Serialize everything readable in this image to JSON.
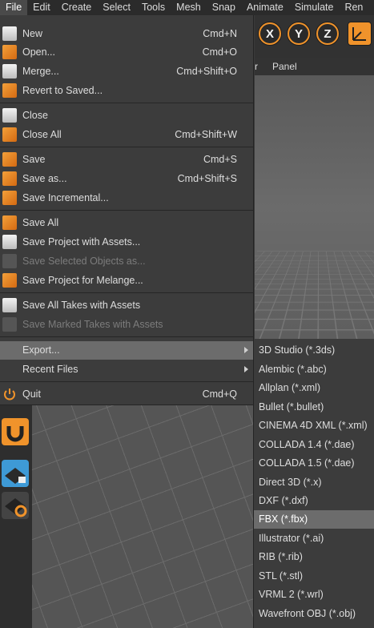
{
  "menubar": {
    "items": [
      "File",
      "Edit",
      "Create",
      "Select",
      "Tools",
      "Mesh",
      "Snap",
      "Animate",
      "Simulate",
      "Ren"
    ]
  },
  "axis_buttons": [
    "X",
    "Y",
    "Z"
  ],
  "viewport_menu": {
    "item_partial": "r",
    "panel": "Panel"
  },
  "file_menu": {
    "new": {
      "label": "New",
      "shortcut": "Cmd+N"
    },
    "open": {
      "label": "Open...",
      "shortcut": "Cmd+O"
    },
    "merge": {
      "label": "Merge...",
      "shortcut": "Cmd+Shift+O"
    },
    "revert": {
      "label": "Revert to Saved..."
    },
    "close": {
      "label": "Close"
    },
    "close_all": {
      "label": "Close All",
      "shortcut": "Cmd+Shift+W"
    },
    "save": {
      "label": "Save",
      "shortcut": "Cmd+S"
    },
    "save_as": {
      "label": "Save as...",
      "shortcut": "Cmd+Shift+S"
    },
    "save_incremental": {
      "label": "Save Incremental..."
    },
    "save_all": {
      "label": "Save All"
    },
    "save_project_assets": {
      "label": "Save Project with Assets..."
    },
    "save_selected": {
      "label": "Save Selected Objects as..."
    },
    "save_melange": {
      "label": "Save Project for Melange..."
    },
    "save_all_takes": {
      "label": "Save All Takes with Assets"
    },
    "save_marked_takes": {
      "label": "Save Marked Takes with Assets"
    },
    "export": {
      "label": "Export..."
    },
    "recent": {
      "label": "Recent Files"
    },
    "quit": {
      "label": "Quit",
      "shortcut": "Cmd+Q"
    }
  },
  "export_submenu": [
    "3D Studio (*.3ds)",
    "Alembic (*.abc)",
    "Allplan (*.xml)",
    "Bullet (*.bullet)",
    "CINEMA 4D XML (*.xml)",
    "COLLADA 1.4 (*.dae)",
    "COLLADA 1.5 (*.dae)",
    "Direct 3D (*.x)",
    "DXF (*.dxf)",
    "FBX (*.fbx)",
    "Illustrator (*.ai)",
    "RIB (*.rib)",
    "STL (*.stl)",
    "VRML 2 (*.wrl)",
    "Wavefront OBJ (*.obj)"
  ],
  "colors": {
    "accent": "#f0932b",
    "highlight": "#6c6c6c",
    "menu_bg": "#3c3c3c"
  }
}
